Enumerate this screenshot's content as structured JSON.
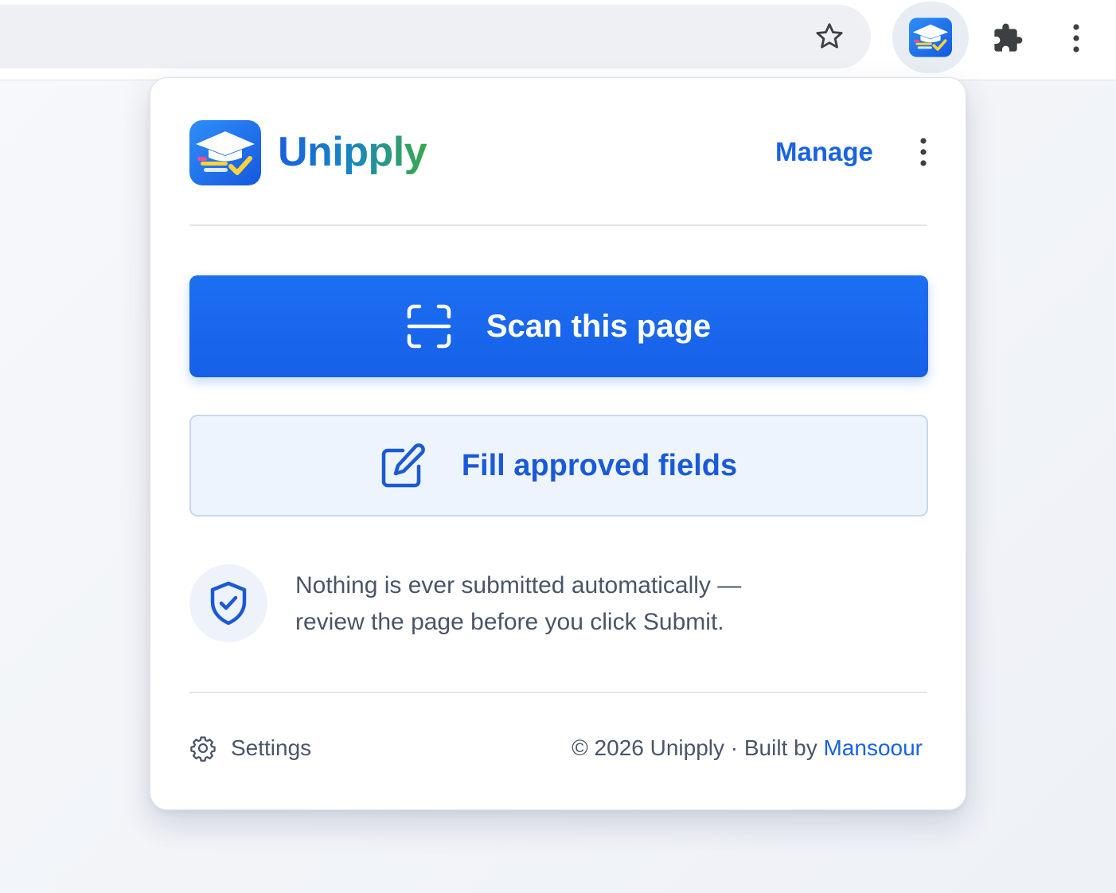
{
  "browser": {
    "omnibox_placeholder": "",
    "icons": [
      "star-icon",
      "unipply-extension-icon",
      "puzzle-icon",
      "more-vert-icon"
    ]
  },
  "popup": {
    "header": {
      "brand_name": "Unipply",
      "manage_label": "Manage"
    },
    "actions": {
      "scan_label": "Scan this page",
      "fill_label": "Fill approved fields"
    },
    "notice": {
      "line1": "Nothing is ever submitted automatically —",
      "line2": "review the page before you click Submit."
    },
    "footer": {
      "settings_label": "Settings",
      "credits_prefix": "© 2026 Unipply · Built by ",
      "author": "Mansoour"
    }
  },
  "colors": {
    "primary": "#1d6ff2",
    "link": "#1a63e0",
    "brand_gradient_start": "#1a5fe0",
    "brand_gradient_end": "#3aa94a",
    "text_muted": "#4a5568"
  }
}
